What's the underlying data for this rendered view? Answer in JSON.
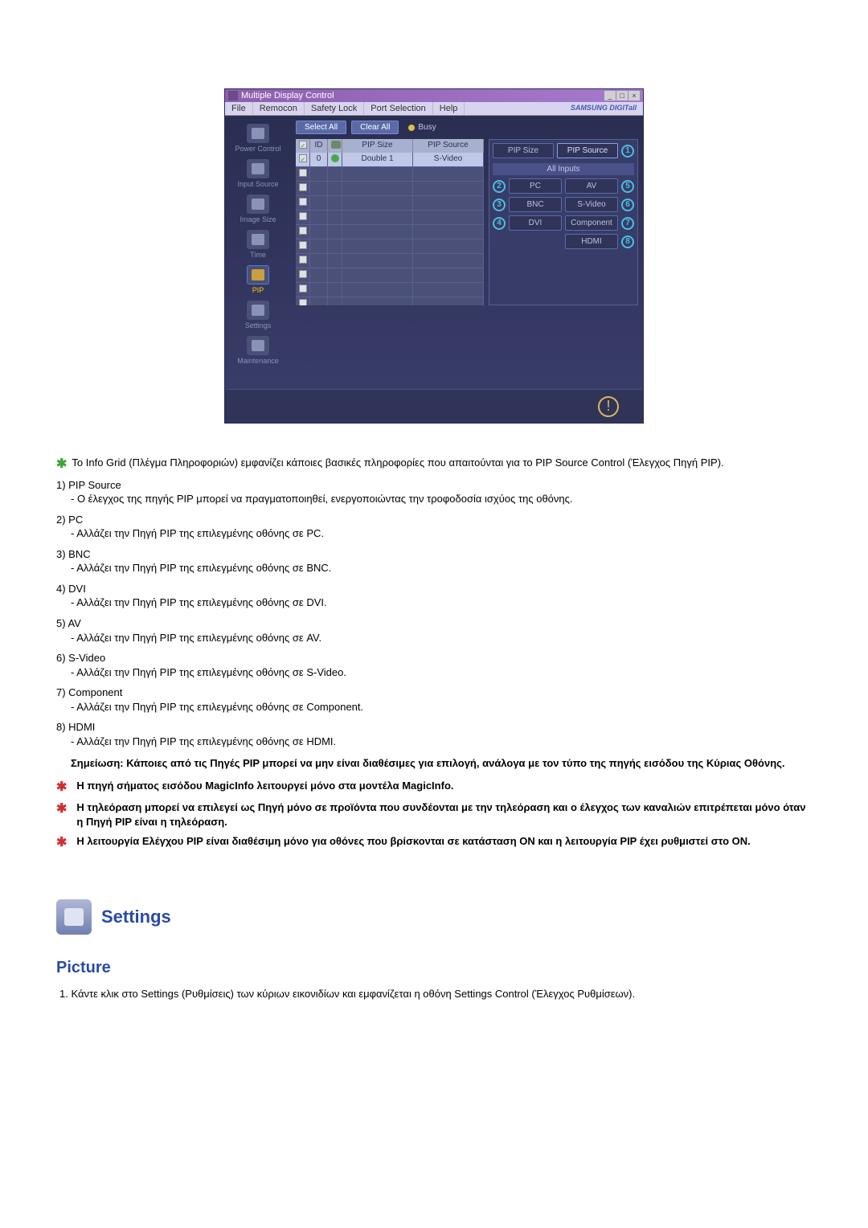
{
  "app": {
    "title": "Multiple Display Control",
    "menu": [
      "File",
      "Remocon",
      "Safety Lock",
      "Port Selection",
      "Help"
    ],
    "brand": "SAMSUNG DIGITall",
    "sidebar": [
      {
        "label": "Power Control"
      },
      {
        "label": "Input Source"
      },
      {
        "label": "Image Size"
      },
      {
        "label": "Time"
      },
      {
        "label": "PIP"
      },
      {
        "label": "Settings"
      },
      {
        "label": "Maintenance"
      }
    ],
    "toolbar": {
      "select_all": "Select All",
      "clear_all": "Clear All",
      "busy": "Busy"
    },
    "grid": {
      "headers": {
        "id": "ID",
        "size": "PIP Size",
        "source": "PIP Source"
      },
      "rows": [
        {
          "id": "0",
          "size": "Double 1",
          "source": "S-Video",
          "checked": true,
          "status": "green"
        }
      ]
    },
    "panel": {
      "pip_size": "PIP Size",
      "pip_source": "PIP Source",
      "all_inputs": "All Inputs",
      "buttons": {
        "pc": "PC",
        "av": "AV",
        "bnc": "BNC",
        "svideo": "S-Video",
        "dvi": "DVI",
        "component": "Component",
        "hdmi": "HDMI"
      },
      "callouts": {
        "c1": "1",
        "c2": "2",
        "c3": "3",
        "c4": "4",
        "c5": "5",
        "c6": "6",
        "c7": "7",
        "c8": "8"
      }
    }
  },
  "doc": {
    "intro": "Το Info Grid (Πλέγμα Πληροφοριών) εμφανίζει κάποιες βασικές πληροφορίες που απαιτούνται για το PIP Source Control (Έλεγχος Πηγή PIP).",
    "items": [
      {
        "num": "1)",
        "title": "PIP Source",
        "desc": "- Ο έλεγχος της πηγής PIP μπορεί να πραγματοποιηθεί, ενεργοποιώντας την τροφοδοσία ισχύος της οθόνης."
      },
      {
        "num": "2)",
        "title": "PC",
        "desc": "- Αλλάζει την Πηγή PIP της επιλεγμένης οθόνης σε PC."
      },
      {
        "num": "3)",
        "title": "BNC",
        "desc": "- Αλλάζει την Πηγή PIP της επιλεγμένης οθόνης σε BNC."
      },
      {
        "num": "4)",
        "title": "DVI",
        "desc": "- Αλλάζει την Πηγή PIP της επιλεγμένης οθόνης σε DVI."
      },
      {
        "num": "5)",
        "title": "AV",
        "desc": "- Αλλάζει την Πηγή PIP της επιλεγμένης οθόνης σε AV."
      },
      {
        "num": "6)",
        "title": "S-Video",
        "desc": "- Αλλάζει την Πηγή PIP της επιλεγμένης οθόνης σε S-Video."
      },
      {
        "num": "7)",
        "title": "Component",
        "desc": "- Αλλάζει την Πηγή PIP της επιλεγμένης οθόνης σε Component."
      },
      {
        "num": "8)",
        "title": "HDMI",
        "desc": "- Αλλάζει την Πηγή PIP της επιλεγμένης οθόνης σε HDMI."
      }
    ],
    "note": "Σημείωση: Κάποιες από τις Πηγές PIP μπορεί να μην είναι διαθέσιμες για επιλογή, ανάλογα με τον τύπο της πηγής εισόδου της Κύριας Οθόνης.",
    "red_notes": [
      "Η πηγή σήματος εισόδου MagicInfo λειτουργεί μόνο στα μοντέλα MagicInfo.",
      "Η τηλεόραση μπορεί να επιλεγεί ως Πηγή μόνο σε προϊόντα που συνδέονται με την τηλεόραση και ο έλεγχος των καναλιών επιτρέπεται μόνο όταν η Πηγή PIP είναι η τηλεόραση.",
      "Η λειτουργία Ελέγχου PIP είναι διαθέσιμη μόνο για οθόνες που βρίσκονται σε κατάσταση ON και η λειτουργία PIP έχει ρυθμιστεί στο ON."
    ],
    "section_title": "Settings",
    "sub_title": "Picture",
    "ol_item": {
      "num": "1.",
      "text": "Κάντε κλικ στο Settings (Ρυθμίσεις) των κύριων εικονιδίων και εμφανίζεται η οθόνη Settings Control (Έλεγχος Ρυθμίσεων)."
    }
  }
}
